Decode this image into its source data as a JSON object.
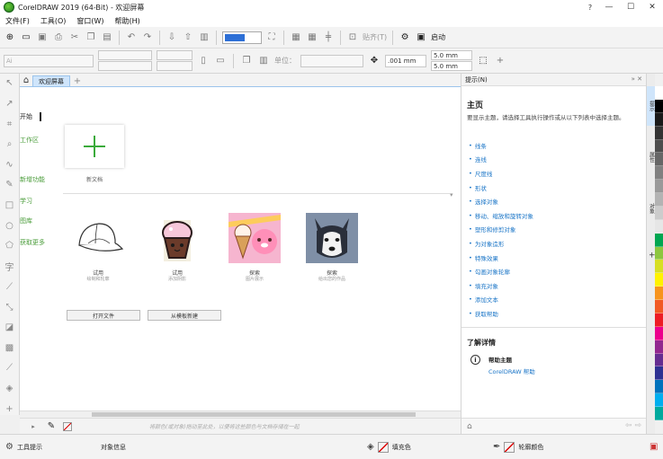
{
  "window": {
    "title": "CorelDRAW 2019 (64-Bit) - 欢迎屏幕",
    "minimize": "—",
    "maximize": "☐",
    "close": "✕",
    "help_btn": "?"
  },
  "menu": {
    "items": [
      "文件(F)",
      "工具(O)",
      "窗口(W)",
      "帮助(H)"
    ]
  },
  "toolbar": {
    "snap_label": "贴齐(T)",
    "launch_label": "启动",
    "font_placeholder": "Ai",
    "unit_label": "单位：",
    "nudge_value": ".001 mm",
    "dup_x": "5.0 mm",
    "dup_y": "5.0 mm"
  },
  "tabs": {
    "home_icon": "home-icon",
    "active_tab": "欢迎屏幕",
    "add": "+"
  },
  "welcome": {
    "nav": [
      {
        "label": "开始",
        "active": true
      },
      {
        "label": "工作区",
        "active": false
      },
      {
        "label": "新增功能",
        "active": false
      },
      {
        "label": "学习",
        "active": false
      },
      {
        "label": "图库",
        "active": false
      },
      {
        "label": "获取更多",
        "active": false
      }
    ],
    "new_doc_label": "新文档",
    "samples": [
      {
        "title": "试用",
        "subtitle": "绘制和轮廓"
      },
      {
        "title": "试用",
        "subtitle": "添加阴影"
      },
      {
        "title": "探索",
        "subtitle": "图片展示"
      },
      {
        "title": "探索",
        "subtitle": "给出您的作品"
      }
    ],
    "open_file_button": "打开文件",
    "from_template_button": "从模板新建"
  },
  "pagebar": {
    "hint": "将颜色(或对象)拖动至此处，以便将这些颜色与文档存储在一起"
  },
  "hints_panel": {
    "title": "提示(N)",
    "heading": "主页",
    "description": "要显示主题，请选择工具执行操作或从以下列表中选择主题。",
    "links": [
      "线条",
      "连线",
      "尺度线",
      "形状",
      "选择对象",
      "移动、缩放和旋转对象",
      "塑形和修剪对象",
      "为对象造形",
      "特殊效果",
      "勾画对象轮廓",
      "填充对象",
      "添加文本",
      "获取帮助"
    ],
    "learn_more_heading": "了解详情",
    "help_topic": "帮助主题",
    "help_link": "CorelDRAW 帮助",
    "info_glyph": "i"
  },
  "vtabs": [
    "提示",
    "属性",
    "对象"
  ],
  "palette_colors": [
    "#ffffff",
    "#000000",
    "#1a1a1a",
    "#333333",
    "#4d4d4d",
    "#666666",
    "#808080",
    "#999999",
    "#b3b3b3",
    "#cccccc",
    "#e6e6e6",
    "#00a651",
    "#8dc63f",
    "#d7df23",
    "#fff200",
    "#f7941d",
    "#f15a24",
    "#ed1c24",
    "#ec008c",
    "#92278f",
    "#662d91",
    "#2e3192",
    "#0072bc",
    "#00aeef",
    "#00a99d"
  ],
  "status": {
    "tool_hint": "工具提示",
    "object_info": "对象信息",
    "fill_color": "填充色",
    "outline_color": "轮廓颜色"
  }
}
